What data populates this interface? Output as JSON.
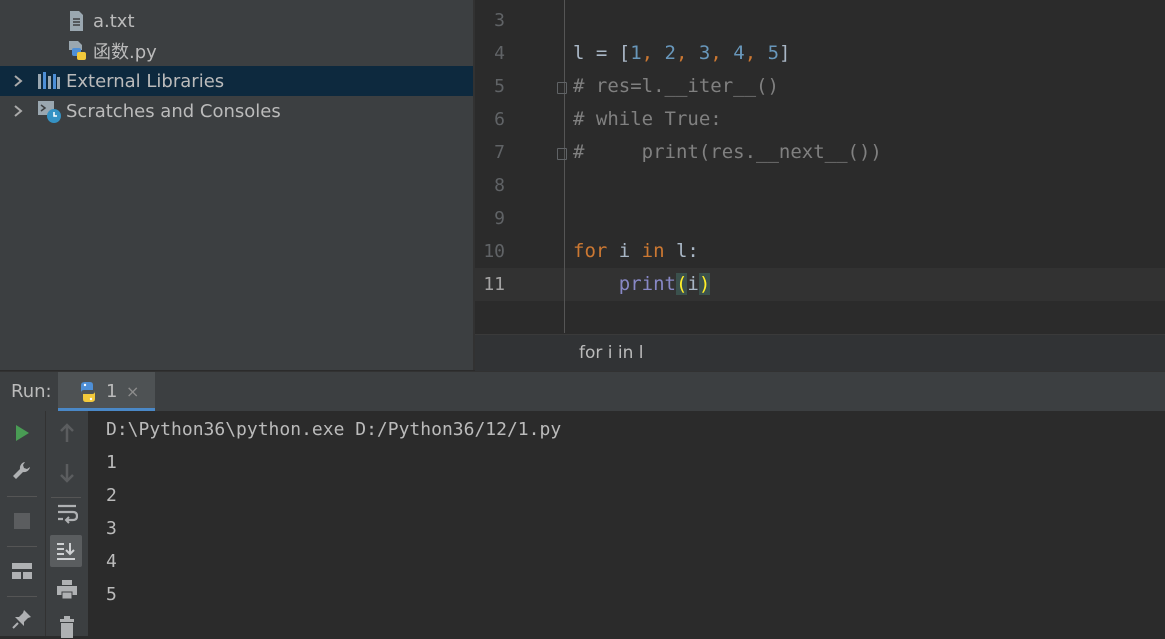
{
  "project_tree": {
    "items": [
      {
        "label": "a.txt",
        "icon": "text-file-icon"
      },
      {
        "label": "函数.py",
        "icon": "python-file-icon"
      },
      {
        "label": "External Libraries",
        "icon": "libraries-icon",
        "selected": true
      },
      {
        "label": "Scratches and Consoles",
        "icon": "scratches-icon"
      }
    ]
  },
  "editor": {
    "line_numbers": [
      "3",
      "4",
      "5",
      "6",
      "7",
      "8",
      "9",
      "10",
      "11"
    ],
    "current_line": "11",
    "lines": {
      "l4": {
        "var": "l = [",
        "n1": "1",
        "c1": ", ",
        "n2": "2",
        "c2": ", ",
        "n3": "3",
        "c3": ", ",
        "n4": "4",
        "c4": ", ",
        "n5": "5",
        "end": "]"
      },
      "l5": "# res=l.__iter__()",
      "l6": "# while True:",
      "l7": "#     print(res.__next__())",
      "l10": {
        "kw1": "for",
        "a": " i ",
        "kw2": "in",
        "b": " l:"
      },
      "l11": {
        "indent": "    ",
        "fn": "print",
        "open": "(",
        "arg": "i",
        "close": ")"
      }
    },
    "breadcrumb": "for i in l"
  },
  "run": {
    "label": "Run:",
    "tab_label": "1",
    "tab_close": "×",
    "console_lines": [
      "D:\\Python36\\python.exe D:/Python36/12/1.py",
      "1",
      "2",
      "3",
      "4",
      "5"
    ]
  },
  "colors": {
    "keyword": "#cc7832",
    "number": "#6897bb",
    "comment": "#808080",
    "builtin": "#8888c6",
    "selection": "#0d293e",
    "run_green": "#499c54"
  }
}
